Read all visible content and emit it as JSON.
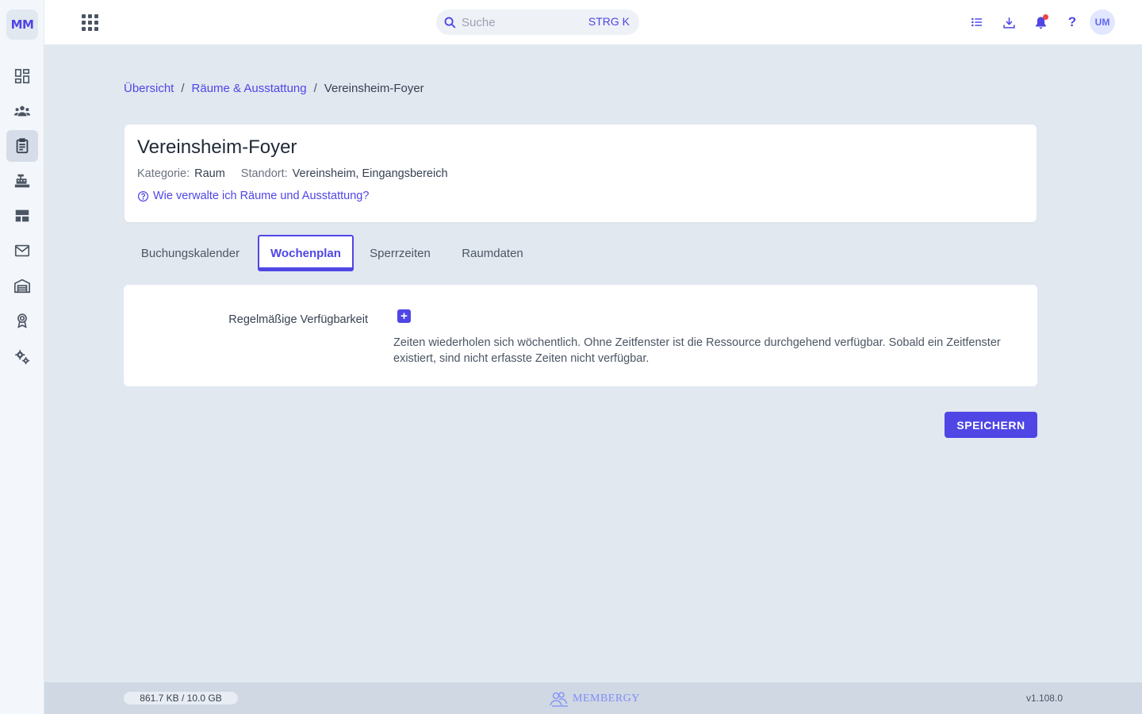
{
  "app": {
    "logo_text": "MM",
    "accent_color": "#4f46e5"
  },
  "sidebar": {
    "items": [
      {
        "icon": "dashboard-icon",
        "active": false
      },
      {
        "icon": "members-icon",
        "active": false
      },
      {
        "icon": "clipboard-icon",
        "active": true
      },
      {
        "icon": "cash-register-icon",
        "active": false
      },
      {
        "icon": "layout-icon",
        "active": false
      },
      {
        "icon": "mail-icon",
        "active": false
      },
      {
        "icon": "warehouse-icon",
        "active": false
      },
      {
        "icon": "award-icon",
        "active": false
      },
      {
        "icon": "settings-icon",
        "active": false
      }
    ]
  },
  "topbar": {
    "search_placeholder": "Suche",
    "search_shortcut": "STRG K",
    "help_label": "?",
    "avatar_initials": "UM"
  },
  "breadcrumb": {
    "items": [
      "Übersicht",
      "Räume & Ausstattung"
    ],
    "separator": "/",
    "current": "Vereinsheim-Foyer"
  },
  "header": {
    "title": "Vereinsheim-Foyer",
    "category_label": "Kategorie:",
    "category_value": "Raum",
    "location_label": "Standort:",
    "location_value": "Vereinsheim, Eingangsbereich",
    "help_link": "Wie verwalte ich Räume und Ausstattung?"
  },
  "tabs": [
    {
      "label": "Buchungskalender",
      "active": false
    },
    {
      "label": "Wochenplan",
      "active": true
    },
    {
      "label": "Sperrzeiten",
      "active": false
    },
    {
      "label": "Raumdaten",
      "active": false
    }
  ],
  "availability": {
    "label": "Regelmäßige Verfügbarkeit",
    "add_symbol": "+",
    "hint": "Zeiten wiederholen sich wöchentlich. Ohne Zeitfenster ist die Ressource durchgehend verfügbar. Sobald ein Zeitfenster existiert, sind nicht erfasste Zeiten nicht verfügbar."
  },
  "actions": {
    "save_label": "SPEICHERN"
  },
  "footer": {
    "storage": "861.7 KB / 10.0 GB",
    "brand": "MEMBERGY",
    "version": "v1.108.0"
  }
}
